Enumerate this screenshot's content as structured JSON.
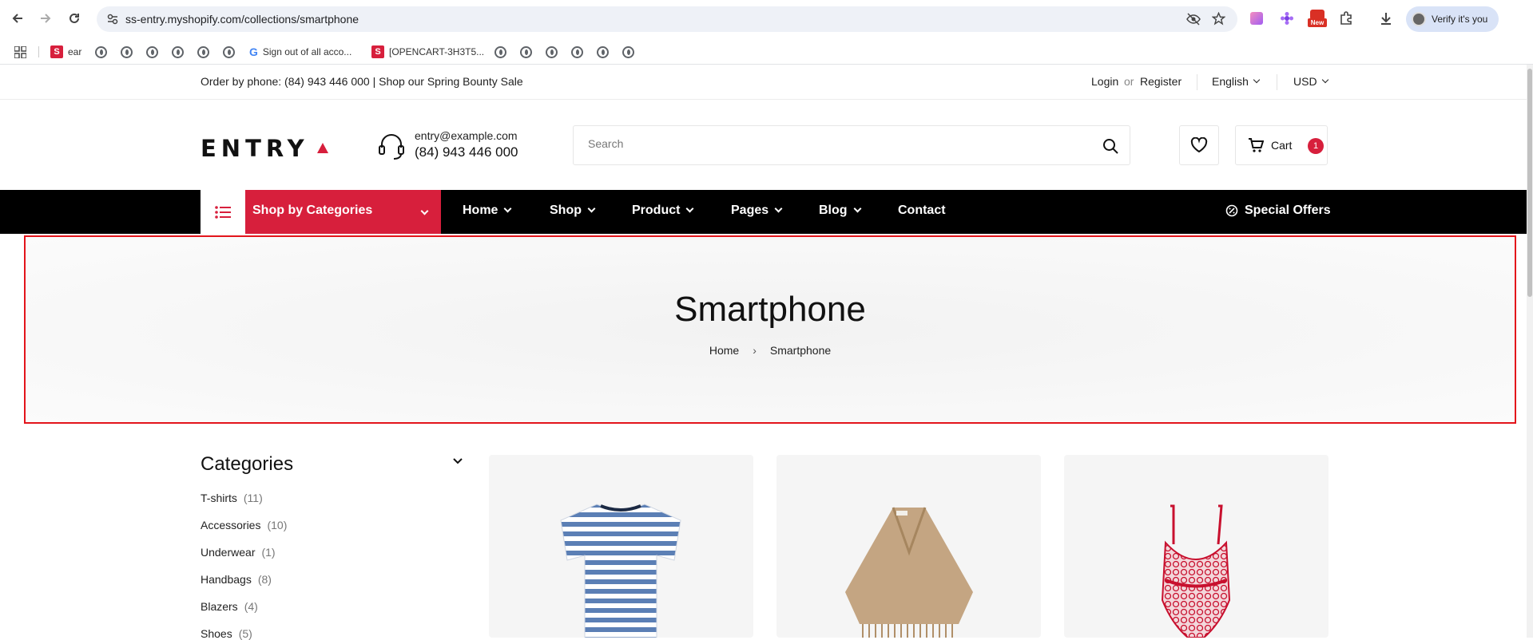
{
  "browser": {
    "url": "ss-entry.myshopify.com/collections/smartphone",
    "profile_label": "Verify it's you",
    "new_badge": "New",
    "bookmarks": {
      "ear": "ear",
      "google_signout": "Sign out of all acco...",
      "opencart": "[OPENCART-3H3T5...",
      "s_letter": "S",
      "g_letter": "G"
    }
  },
  "topbar": {
    "announcement": "Order by phone: (84) 943 446 000 | Shop our Spring Bounty Sale",
    "login": "Login",
    "or": "or",
    "register": "Register",
    "language": "English",
    "currency": "USD"
  },
  "header": {
    "logo": "ENTRY",
    "email": "entry@example.com",
    "phone": "(84) 943 446 000",
    "search_placeholder": "Search",
    "cart_label": "Cart",
    "cart_count": "1"
  },
  "nav": {
    "shop_by_categories": "Shop by Categories",
    "items": [
      "Home",
      "Shop",
      "Product",
      "Pages",
      "Blog",
      "Contact"
    ],
    "special_offers": "Special Offers"
  },
  "banner": {
    "title": "Smartphone",
    "breadcrumb_home": "Home",
    "breadcrumb_sep": "›",
    "breadcrumb_current": "Smartphone"
  },
  "sidebar": {
    "title": "Categories",
    "categories": [
      {
        "name": "T-shirts",
        "count": "(11)"
      },
      {
        "name": "Accessories",
        "count": "(10)"
      },
      {
        "name": "Underwear",
        "count": "(1)"
      },
      {
        "name": "Handbags",
        "count": "(8)"
      },
      {
        "name": "Blazers",
        "count": "(4)"
      },
      {
        "name": "Shoes",
        "count": "(5)"
      }
    ]
  },
  "colors": {
    "accent": "#d71f3c",
    "nav_bg": "#000000",
    "highlight_border": "#e3141b"
  }
}
